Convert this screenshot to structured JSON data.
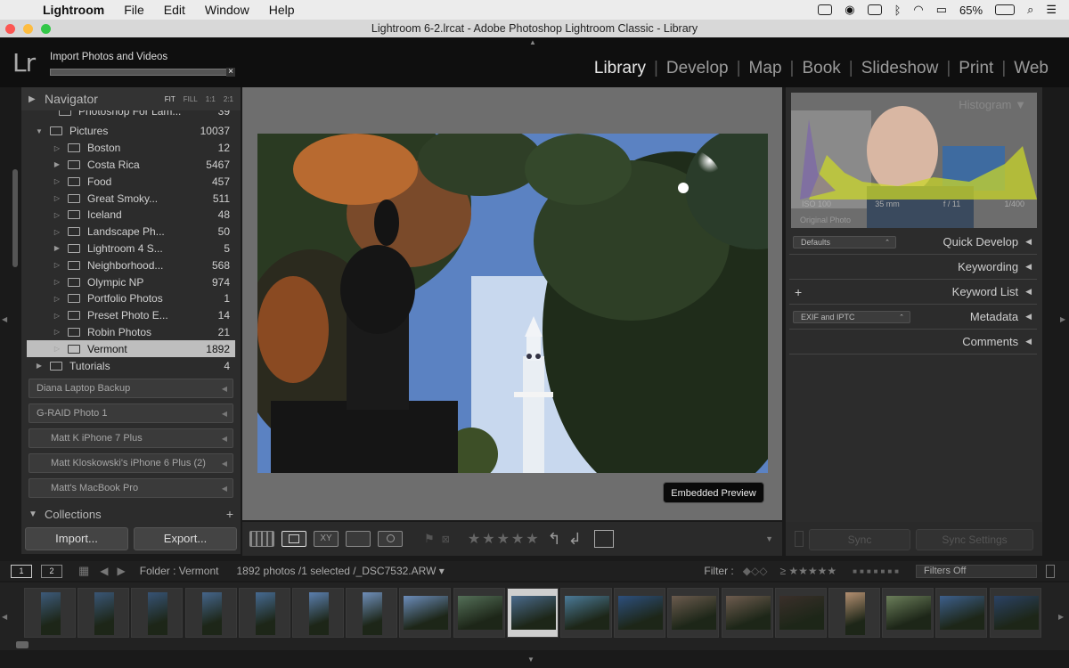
{
  "menubar": {
    "items": [
      "Lightroom",
      "File",
      "Edit",
      "Window",
      "Help"
    ],
    "battery": "65%"
  },
  "window": {
    "title": "Lightroom 6-2.lrcat - Adobe Photoshop Lightroom Classic - Library"
  },
  "identity": {
    "logo": "Lr",
    "task": "Import Photos and Videos",
    "close": "×",
    "modules": [
      "Library",
      "Develop",
      "Map",
      "Book",
      "Slideshow",
      "Print",
      "Web"
    ],
    "active_module": "Library"
  },
  "navigator": {
    "title": "Navigator",
    "zoom": [
      "FIT",
      "FILL",
      "1:1",
      "2:1"
    ]
  },
  "folders": {
    "partial": {
      "name": "Photoshop For Lam...",
      "count": "39"
    },
    "parent": {
      "name": "Pictures",
      "count": "10037"
    },
    "items": [
      {
        "name": "Boston",
        "count": "12"
      },
      {
        "name": "Costa Rica",
        "count": "5467"
      },
      {
        "name": "Food",
        "count": "457"
      },
      {
        "name": "Great Smoky...",
        "count": "511"
      },
      {
        "name": "Iceland",
        "count": "48"
      },
      {
        "name": "Landscape Ph...",
        "count": "50"
      },
      {
        "name": "Lightroom 4 S...",
        "count": "5"
      },
      {
        "name": "Neighborhood...",
        "count": "568"
      },
      {
        "name": "Olympic NP",
        "count": "974"
      },
      {
        "name": "Portfolio Photos",
        "count": "1"
      },
      {
        "name": "Preset Photo E...",
        "count": "14"
      },
      {
        "name": "Robin Photos",
        "count": "21"
      },
      {
        "name": "Vermont",
        "count": "1892"
      }
    ],
    "tutorials": {
      "name": "Tutorials",
      "count": "4"
    }
  },
  "volumes": [
    "Diana Laptop Backup",
    "G-RAID Photo 1",
    "Matt K iPhone 7 Plus",
    "Matt Kloskowski's iPhone 6 Plus (2)",
    "Matt's MacBook Pro"
  ],
  "collections": {
    "title": "Collections",
    "plus": "+"
  },
  "left_buttons": {
    "import": "Import...",
    "export": "Export..."
  },
  "center": {
    "embedded_preview": "Embedded Preview"
  },
  "toolbar": {
    "view_modes": [
      "grid",
      "loupe",
      "compare",
      "survey",
      "people"
    ],
    "stars": "★★★★★"
  },
  "histogram": {
    "title": "Histogram",
    "exif": [
      "ISO 100",
      "35 mm",
      "f / 11",
      "1/400"
    ],
    "original": "Original Photo"
  },
  "right_panels": {
    "quick_develop": {
      "preset": "Defaults",
      "label": "Quick Develop"
    },
    "keywording": {
      "label": "Keywording"
    },
    "keyword_list": {
      "label": "Keyword List",
      "plus": "+"
    },
    "metadata": {
      "preset": "EXIF and IPTC",
      "label": "Metadata"
    },
    "comments": {
      "label": "Comments"
    }
  },
  "right_buttons": {
    "sync": "Sync",
    "sync_settings": "Sync Settings"
  },
  "filmbar": {
    "monitor1": "1",
    "monitor2": "2",
    "path": "Folder : Vermont",
    "status": "1892 photos /1 selected /_DSC7532.ARW ▾",
    "filter_label": "Filter :",
    "filter_stars": "★★★★★",
    "filters_off": "Filters Off"
  },
  "filmstrip": {
    "thumbs": [
      {
        "orientation": "portrait",
        "color": "#3d5a7a"
      },
      {
        "orientation": "portrait",
        "color": "#3a5676"
      },
      {
        "orientation": "portrait",
        "color": "#375375"
      },
      {
        "orientation": "portrait",
        "color": "#45658b"
      },
      {
        "orientation": "portrait",
        "color": "#466a92"
      },
      {
        "orientation": "portrait",
        "color": "#5b7fae"
      },
      {
        "orientation": "portrait",
        "color": "#6f8fba"
      },
      {
        "orientation": "landscape",
        "color": "#6c8dbb"
      },
      {
        "orientation": "landscape",
        "color": "#546f58"
      },
      {
        "orientation": "landscape",
        "color": "#4a6a8c",
        "selected": true
      },
      {
        "orientation": "landscape",
        "color": "#4b7a98"
      },
      {
        "orientation": "landscape",
        "color": "#2d4f7d"
      },
      {
        "orientation": "landscape",
        "color": "#6b5b4e"
      },
      {
        "orientation": "landscape",
        "color": "#6e5c4f"
      },
      {
        "orientation": "landscape",
        "color": "#3a2f2a"
      },
      {
        "orientation": "portrait",
        "color": "#b38f71"
      },
      {
        "orientation": "landscape",
        "color": "#6b7e5a"
      },
      {
        "orientation": "landscape",
        "color": "#3d5f8c"
      },
      {
        "orientation": "landscape",
        "color": "#2b4264"
      }
    ]
  }
}
